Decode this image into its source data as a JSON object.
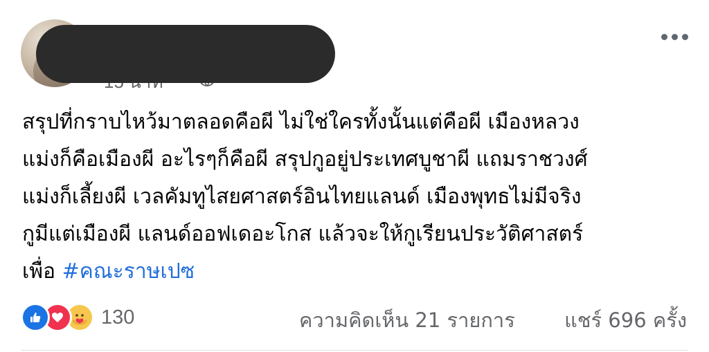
{
  "post": {
    "timestamp": "15 นาที",
    "author_redacted": true,
    "body_lines": [
      "สรุปที่กราบไหว้มาตลอดคือผี ไม่ใช่ใครทั้งนั้นแต่คือผี เมืองหลวง",
      "แม่งก็คือเมืองผี อะไรๆก็คือผี สรุปกูอยู่ประเทศบูชาผี แถมราชวงศ์",
      "แม่งก็เลี้ยงผี เวลคัมทูไสยศาสตร์อินไทยแลนด์ เมืองพุทธไม่มีจริง",
      "กูมีแต่เมืองผี แลนด์ออฟเดอะโกส แล้วจะให้กูเรียนประวัติศาสตร์"
    ],
    "last_line_prefix": "เพื่อ ",
    "hashtag": "#คณะราษเปซ",
    "icons": {
      "more": "more-dots-icon",
      "privacy": "globe-icon"
    }
  },
  "engagement": {
    "reactions": [
      "like-reaction-icon",
      "love-reaction-icon",
      "care-reaction-icon"
    ],
    "reaction_count": "130",
    "comments": "ความคิดเห็น 21 รายการ",
    "shares": "แชร์ 696 ครั้ง",
    "colors": {
      "like": "#1b74e4",
      "love": "#f0324f",
      "care": "#f7c64d",
      "hashtag": "#216fdb",
      "meta_text": "#65676b"
    }
  }
}
